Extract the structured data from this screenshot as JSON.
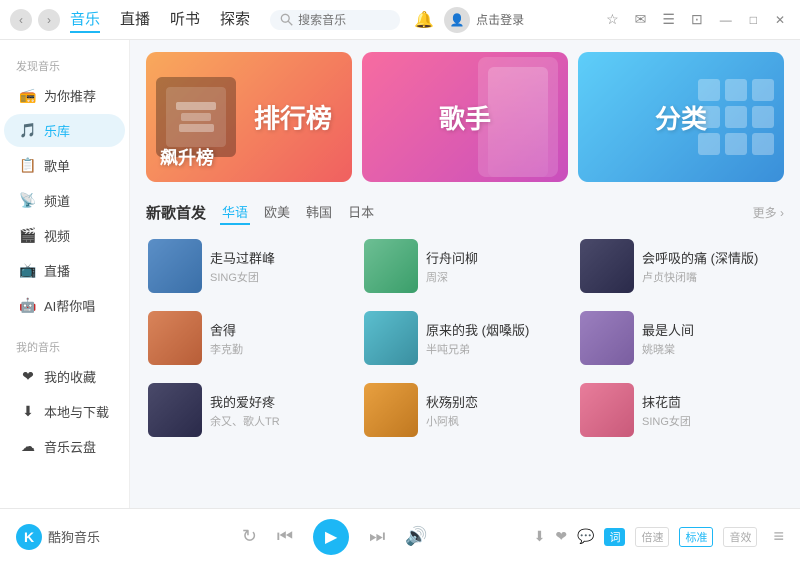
{
  "titleBar": {
    "navBack": "‹",
    "navForward": "›",
    "mainNav": [
      {
        "label": "音乐",
        "active": true
      },
      {
        "label": "直播",
        "active": false
      },
      {
        "label": "听书",
        "active": false
      },
      {
        "label": "探索",
        "active": false
      }
    ],
    "searchPlaceholder": "搜索音乐",
    "bellLabel": "🔔",
    "loginText": "点击登录",
    "icons": [
      "⭐",
      "✉",
      "☰",
      "⊡",
      "—",
      "□",
      "✕"
    ]
  },
  "sidebar": {
    "discoverTitle": "发现音乐",
    "items": [
      {
        "label": "为你推荐",
        "icon": "📻",
        "active": false
      },
      {
        "label": "乐库",
        "icon": "🎵",
        "active": true
      },
      {
        "label": "歌单",
        "icon": "📋",
        "active": false
      },
      {
        "label": "频道",
        "icon": "📡",
        "active": false
      },
      {
        "label": "视频",
        "icon": "🎬",
        "active": false
      },
      {
        "label": "直播",
        "icon": "📺",
        "active": false
      },
      {
        "label": "AI帮你唱",
        "icon": "🤖",
        "active": false
      }
    ],
    "myMusicTitle": "我的音乐",
    "myItems": [
      {
        "label": "我的收藏",
        "icon": "❤",
        "active": false
      },
      {
        "label": "本地与下载",
        "icon": "⬇",
        "active": false
      },
      {
        "label": "音乐云盘",
        "icon": "☁",
        "active": false
      }
    ]
  },
  "banners": [
    {
      "title": "排行榜",
      "subtitle": "飙升榜",
      "type": "chart"
    },
    {
      "title": "歌手",
      "type": "artist"
    },
    {
      "title": "分类",
      "type": "category"
    }
  ],
  "newSongs": {
    "sectionTitle": "新歌首发",
    "filters": [
      {
        "label": "华语",
        "active": true
      },
      {
        "label": "欧美",
        "active": false
      },
      {
        "label": "韩国",
        "active": false
      },
      {
        "label": "日本",
        "active": false
      }
    ],
    "more": "更多 ›",
    "songs": [
      {
        "name": "走马过群峰",
        "artist": "SING女团",
        "thumbClass": "thumb-blue"
      },
      {
        "name": "行舟问柳",
        "artist": "周深",
        "thumbClass": "thumb-green"
      },
      {
        "name": "会呼吸的痛 (深情版)",
        "artist": "卢贞快闭嘴",
        "thumbClass": "thumb-dark"
      },
      {
        "name": "舍得",
        "artist": "李克勤",
        "thumbClass": "thumb-warm"
      },
      {
        "name": "原来的我 (烟嗓版)",
        "artist": "半吨兄弟",
        "thumbClass": "thumb-teal"
      },
      {
        "name": "最是人间",
        "artist": "姚晓棠",
        "thumbClass": "thumb-purple"
      },
      {
        "name": "我的爱好疼",
        "artist": "余又、歌人TR",
        "thumbClass": "thumb-dark"
      },
      {
        "name": "秋殇别恋",
        "artist": "小阿枫",
        "thumbClass": "thumb-orange"
      },
      {
        "name": "抹花茴",
        "artist": "SING女团",
        "thumbClass": "thumb-pink"
      }
    ]
  },
  "bottomBar": {
    "logoK": "K",
    "logoText": "酷狗音乐",
    "controls": {
      "loop": "↻",
      "prev": "⏮",
      "play": "▶",
      "next": "⏭",
      "volume": "🔊"
    },
    "rightControls": {
      "download": "⬇",
      "love": "❤",
      "comment": "💬",
      "lyric": "词",
      "speedLabels": [
        "倍速",
        "标准",
        "音效"
      ]
    },
    "playlist": "≡"
  }
}
